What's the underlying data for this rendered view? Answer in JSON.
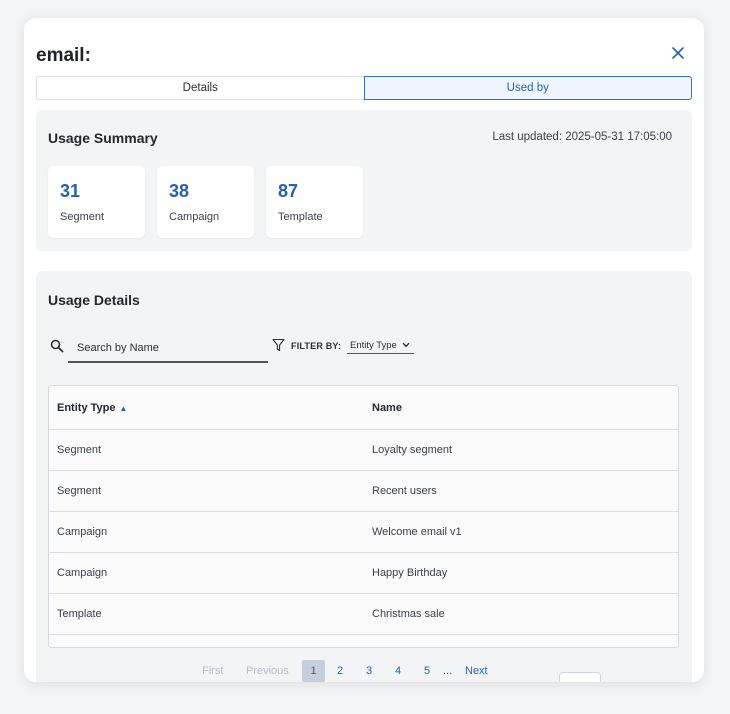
{
  "modal": {
    "title": "email:",
    "tabs": [
      {
        "label": "Details",
        "active": false
      },
      {
        "label": "Used by",
        "active": true
      }
    ]
  },
  "summary": {
    "title": "Usage Summary",
    "last_updated": "Last updated: 2025-05-31 17:05:00",
    "cards": [
      {
        "value": "31",
        "label": "Segment"
      },
      {
        "value": "38",
        "label": "Campaign"
      },
      {
        "value": "87",
        "label": "Template"
      }
    ]
  },
  "details": {
    "title": "Usage Details",
    "search_placeholder": "Search by Name",
    "filter_label": "FILTER BY:",
    "filter_value": "Entity Type",
    "table": {
      "headers": [
        "Entity Type",
        "Name"
      ],
      "sort_indicator": "▲",
      "rows": [
        [
          "Segment",
          "Loyalty segment"
        ],
        [
          "Segment",
          "Recent users"
        ],
        [
          "Campaign",
          "Welcome email v1"
        ],
        [
          "Campaign",
          "Happy Birthday"
        ],
        [
          "Template",
          "Christmas sale"
        ]
      ]
    },
    "pagination": {
      "first": "First",
      "previous": "Previous",
      "pages": [
        "1",
        "2",
        "3",
        "4",
        "5"
      ],
      "current": "1",
      "ellipsis": "...",
      "next": "Next"
    }
  },
  "colors": {
    "accent": "#2460b5",
    "panel_bg": "#f3f4f6",
    "active_tab_bg": "#eef5fd"
  },
  "icons": {
    "close": "close-icon",
    "search": "search-icon",
    "filter": "filter-icon",
    "sort": "sort-ascending-icon"
  }
}
